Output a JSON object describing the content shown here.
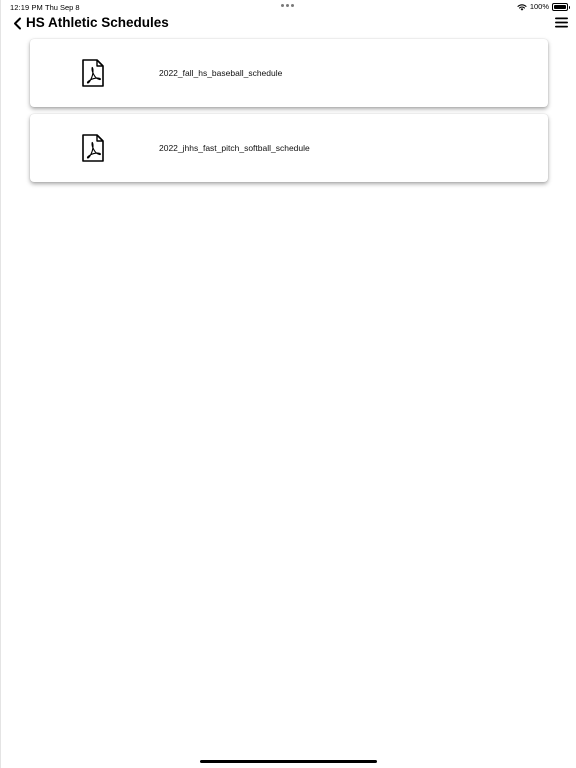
{
  "status_bar": {
    "time": "12:19 PM",
    "date": "Thu Sep 8",
    "battery": "100%",
    "icons": [
      "wifi-icon",
      "battery-icon"
    ]
  },
  "header": {
    "title": "HS Athletic Schedules",
    "back_icon": "chevron-left-icon",
    "menu_icon": "hamburger-menu-icon"
  },
  "documents": [
    {
      "name": "2022_fall_hs_baseball_schedule",
      "icon": "pdf-file-icon"
    },
    {
      "name": "2022_jhhs_fast_pitch_softball_schedule",
      "icon": "pdf-file-icon"
    }
  ],
  "colors": {
    "background": "#ffffff",
    "text": "#000000",
    "card_shadow": "#a0a0a0"
  }
}
